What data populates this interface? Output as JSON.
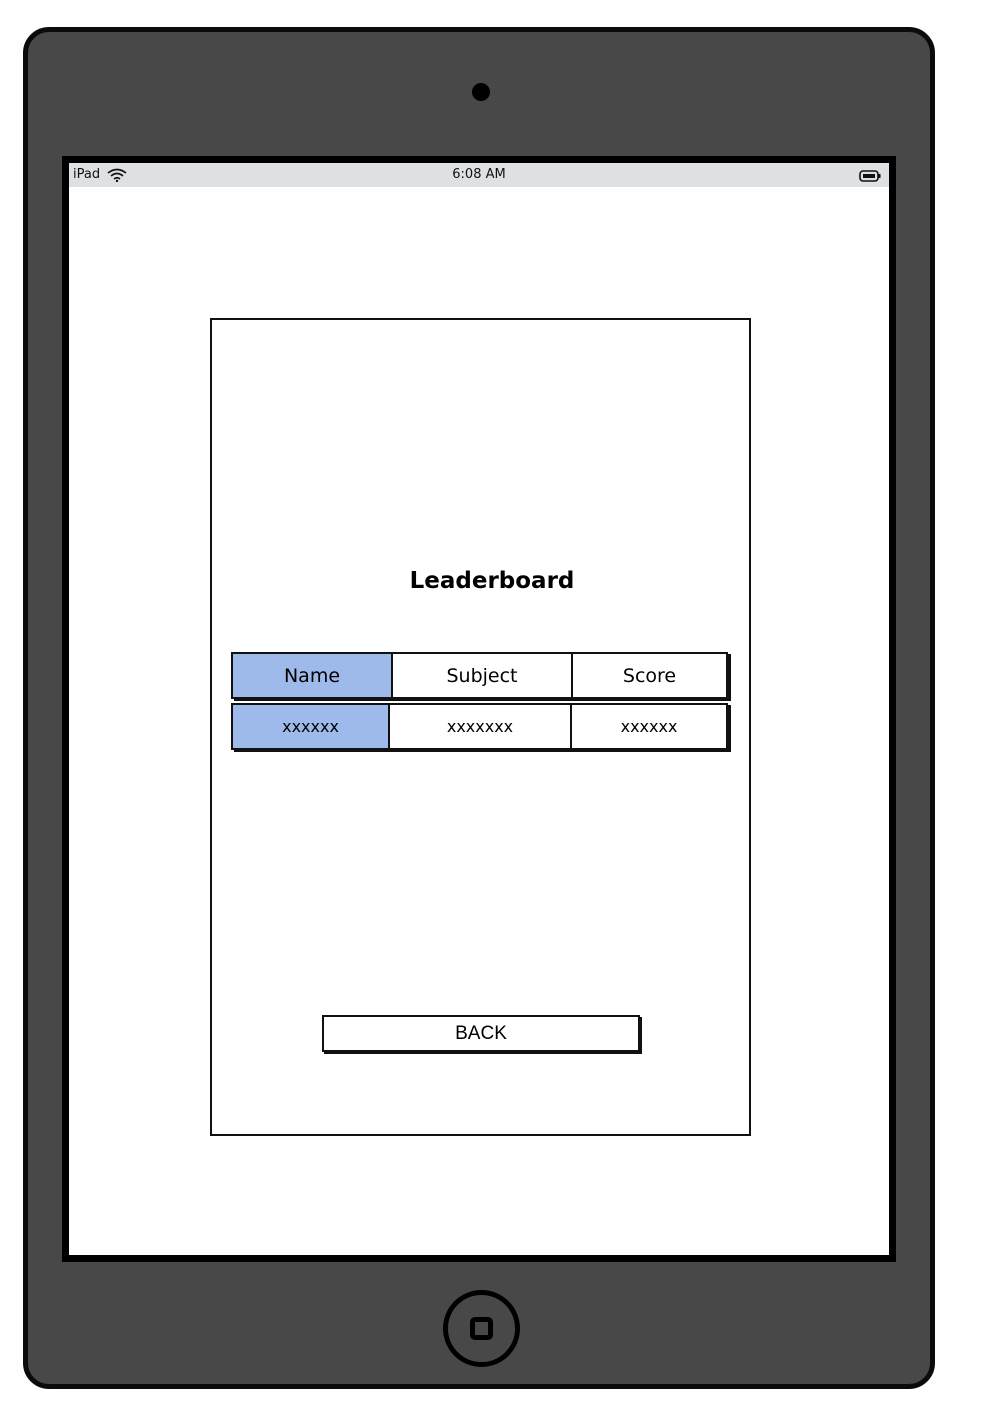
{
  "status_bar": {
    "device_label": "iPad",
    "time": "6:08 AM",
    "wifi_icon": "wifi-icon",
    "battery_icon": "battery-icon"
  },
  "screen": {
    "title": "Leaderboard",
    "table": {
      "columns": [
        "Name",
        "Subject",
        "Score"
      ],
      "rows": [
        [
          "xxxxxx",
          "xxxxxxx",
          "xxxxxx"
        ]
      ]
    },
    "back_label": "BACK"
  },
  "colors": {
    "device_frame": "#484848",
    "status_bar": "#dde1e4",
    "accent_cell": "#9ebaea"
  }
}
